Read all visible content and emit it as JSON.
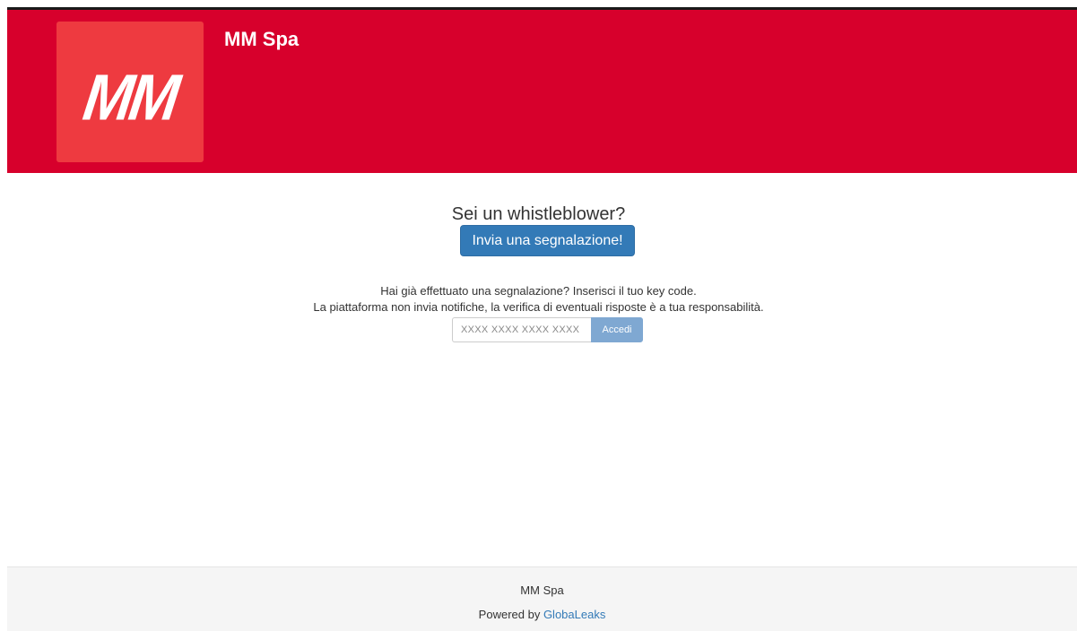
{
  "header": {
    "logo_text": "MM",
    "site_title": "MM Spa",
    "background_color": "#d7002c",
    "logo_color": "#ee3a40"
  },
  "main": {
    "question": "Sei un whistleblower?",
    "submit_button_label": "Invia una segnalazione!",
    "info_line_1": "Hai già effettuato una segnalazione? Inserisci il tuo key code.",
    "info_line_2": "La piattaforma non invia notifiche, la verifica di eventuali risposte è a tua responsabilità.",
    "key_input_value": "",
    "key_input_placeholder": "XXXX XXXX XXXX XXXX",
    "login_button_label": "Accedi",
    "primary_color": "#337ab7"
  },
  "footer": {
    "org_name": "MM Spa",
    "powered_prefix": "Powered by",
    "powered_link": "GlobaLeaks"
  }
}
